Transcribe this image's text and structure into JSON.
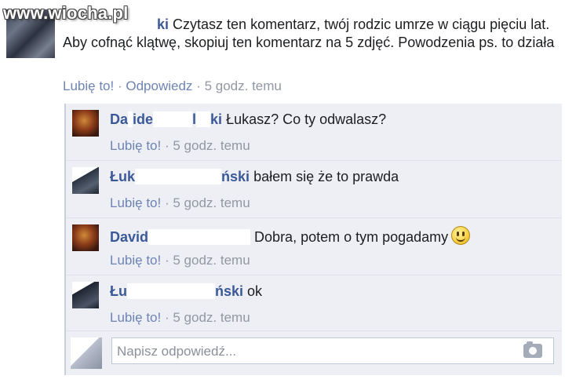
{
  "watermark": "www.wiocha.pl",
  "main_comment": {
    "author_partial": "ki",
    "text": "Czytasz ten komentarz, twój rodzic umrze w ciągu pięciu lat. Aby cofnąć klątwę, skopiuj ten komentarz na 5 zdjęć. Powodzenia ps. to działa",
    "like_label": "Lubię to!",
    "reply_label": "Odpowiedz",
    "separator": "·",
    "time": "5 godz. temu"
  },
  "replies": [
    {
      "author_start": "Da",
      "author_mid": "ide",
      "author_end": "ki",
      "text": "Łukasz? Co ty odwalasz?",
      "like_label": "Lubię to!",
      "separator": "·",
      "time": "5 godz. temu",
      "avatar": "warm"
    },
    {
      "author_start": "Łuk",
      "author_mid": "",
      "author_end": "ński",
      "text": "bałem się że to prawda",
      "like_label": "Lubię to!",
      "separator": "·",
      "time": "5 godz. temu",
      "avatar": "cool"
    },
    {
      "author_start": "David",
      "author_mid": "",
      "author_end": "",
      "text": "Dobra, potem o tym pogadamy",
      "emoji": "smiley-icon",
      "like_label": "Lubię to!",
      "separator": "·",
      "time": "5 godz. temu",
      "avatar": "warm"
    },
    {
      "author_start": "Łu",
      "author_mid": "",
      "author_end": "ński",
      "text": "ok",
      "like_label": "Lubię to!",
      "separator": "·",
      "time": "5 godz. temu",
      "avatar": "dark"
    }
  ],
  "compose": {
    "placeholder": "Napisz odpowiedź...",
    "camera_icon": "camera-icon"
  },
  "colors": {
    "link": "#3b5998",
    "meta_link": "#6d84b4",
    "meta_gray": "#9197a3",
    "reply_bg": "#edeff4"
  }
}
